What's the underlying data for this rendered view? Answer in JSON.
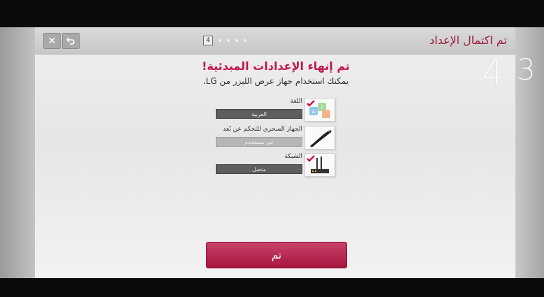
{
  "header": {
    "title": "تم اكتمال الإعداد",
    "close_icon": "✕",
    "back_icon": "⮌",
    "current_step": "4"
  },
  "steps": {
    "current": "4",
    "previous": "3"
  },
  "content": {
    "title": "تم إنهاء الإعدادات المبدئية!",
    "subtitle": "يمكنك استخدام جهاز عرض الليزر من LG."
  },
  "items": [
    {
      "label": "اللغة",
      "value": "العربية",
      "icon": "language-icon",
      "checked": true,
      "enabled": true
    },
    {
      "label": "الجهاز السحري للتحكم عن بُعد",
      "value": "غير مستخدم",
      "icon": "magic-remote-icon",
      "checked": false,
      "enabled": false
    },
    {
      "label": "الشبكة",
      "value": "متصل",
      "icon": "network-router-icon",
      "checked": true,
      "enabled": true
    }
  ],
  "done_button": {
    "label": "تم"
  },
  "colors": {
    "accent": "#c0174d",
    "button": "#b12050",
    "title": "#9c1b3d"
  }
}
